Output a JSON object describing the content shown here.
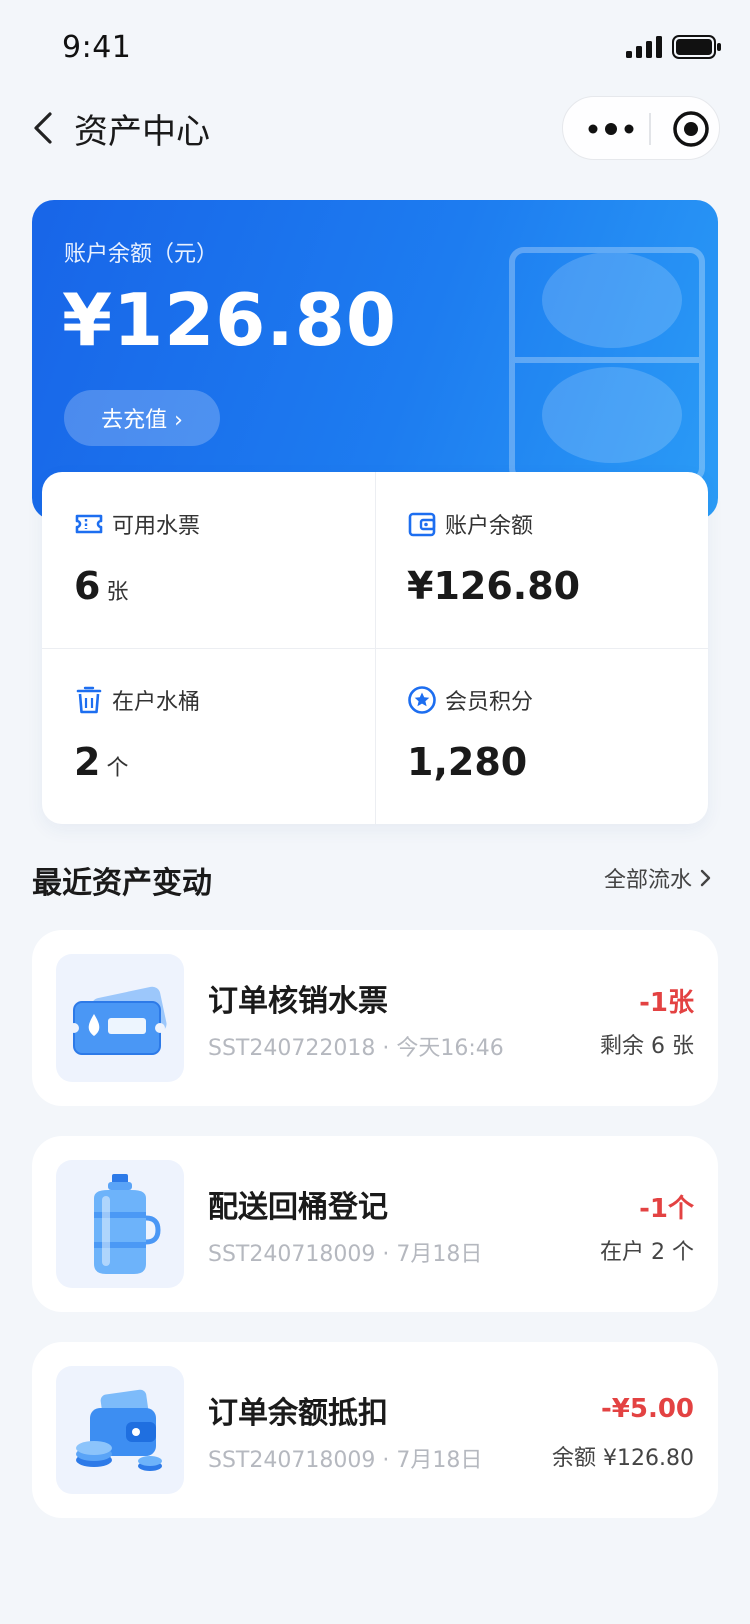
{
  "status_bar": {
    "time": "9:41"
  },
  "nav": {
    "title": "资产中心"
  },
  "balance_card": {
    "label": "账户余额（元）",
    "amount": "¥126.80",
    "recharge_label": "去充值 ›"
  },
  "stats": [
    {
      "label": "可用水票",
      "value": "6",
      "unit": "张",
      "icon": "ticket-icon"
    },
    {
      "label": "账户余额",
      "value": "¥126.80",
      "unit": "",
      "icon": "wallet-icon"
    },
    {
      "label": "在户水桶",
      "value": "2",
      "unit": "个",
      "icon": "bucket-icon"
    },
    {
      "label": "会员积分",
      "value": "1,280",
      "unit": "",
      "icon": "star-badge-icon"
    }
  ],
  "section": {
    "title": "最近资产变动",
    "link": "全部流水"
  },
  "transactions": [
    {
      "title": "订单核销水票",
      "meta": "SST240722018 · 今天16:46",
      "change": "-1张",
      "remain": "剩余 6 张",
      "thumb": "water-ticket-image"
    },
    {
      "title": "配送回桶登记",
      "meta": "SST240718009 · 7月18日",
      "change": "-1个",
      "remain": "在户 2 个",
      "thumb": "water-bottle-image"
    },
    {
      "title": "订单余额抵扣",
      "meta": "SST240718009 · 7月18日",
      "change": "-¥5.00",
      "remain": "余额 ¥126.80",
      "thumb": "wallet-coins-image"
    }
  ],
  "colors": {
    "accent": "#1d6ef0",
    "negative": "#e34242",
    "background": "#f3f6fa"
  }
}
